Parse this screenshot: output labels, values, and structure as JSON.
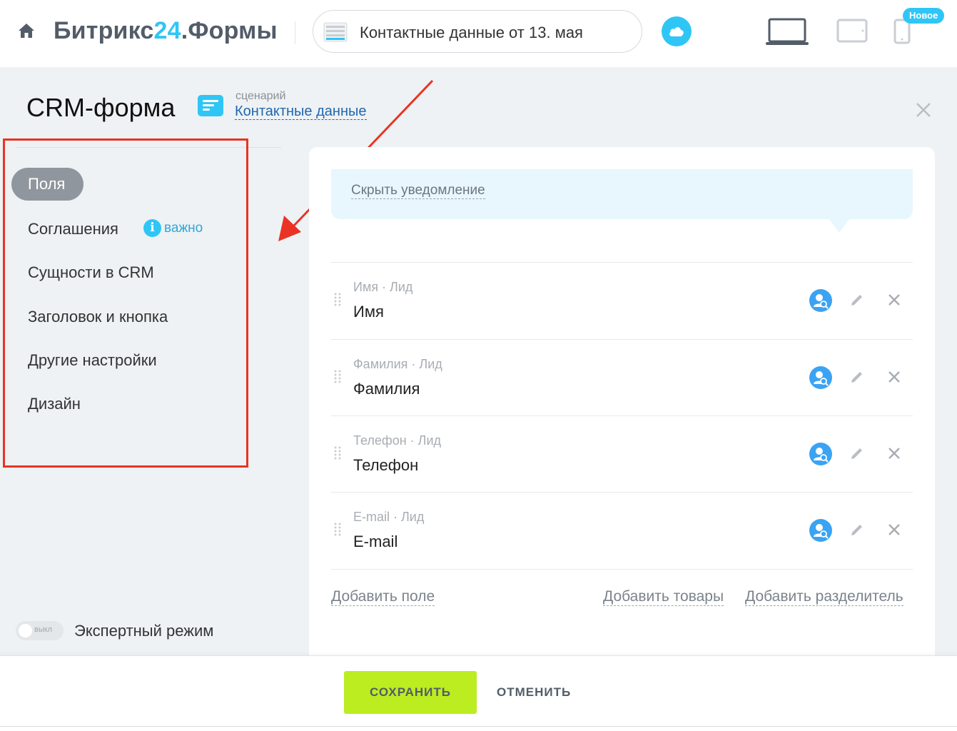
{
  "topbar": {
    "brand_part1": "Битрикс",
    "brand_part2": "24",
    "brand_part3": ".Формы",
    "form_selector_value": "Контактные данные от 13. мая",
    "new_badge": "Новое",
    "devices": [
      "laptop-icon",
      "tablet-icon",
      "phone-icon"
    ]
  },
  "header": {
    "title": "CRM-форма",
    "scenario_caption": "сценарий",
    "scenario_link": "Контактные данные"
  },
  "sidebar": {
    "items": [
      {
        "label": "Поля",
        "active": true
      },
      {
        "label": "Соглашения",
        "badge": "важно"
      },
      {
        "label": "Сущности в CRM"
      },
      {
        "label": "Заголовок и кнопка"
      },
      {
        "label": "Другие настройки"
      },
      {
        "label": "Дизайн"
      }
    ],
    "expert_toggle_state": "выкл",
    "expert_label": "Экспертный режим"
  },
  "main": {
    "notice_link": "Скрыть уведомление",
    "fields": [
      {
        "meta": "Имя · Лид",
        "name": "Имя"
      },
      {
        "meta": "Фамилия · Лид",
        "name": "Фамилия"
      },
      {
        "meta": "Телефон · Лид",
        "name": "Телефон"
      },
      {
        "meta": "E-mail · Лид",
        "name": "E-mail"
      }
    ],
    "add_field": "Добавить поле",
    "add_products": "Добавить товары",
    "add_separator": "Добавить разделитель"
  },
  "footer": {
    "save": "СОХРАНИТЬ",
    "cancel": "ОТМЕНИТЬ"
  },
  "colors": {
    "accent": "#2fc6f6",
    "save_button": "#bbed21",
    "annotation": "#ea3324",
    "crm_icon": "#3ba3f3"
  }
}
